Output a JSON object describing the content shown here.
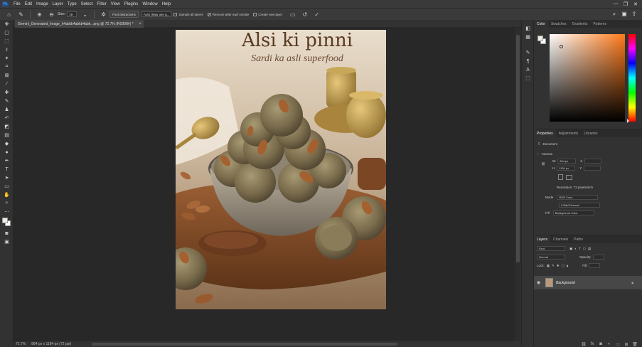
{
  "app": {
    "logo": "Ps"
  },
  "menu": [
    "File",
    "Edit",
    "Image",
    "Layer",
    "Type",
    "Select",
    "Filter",
    "View",
    "Plugins",
    "Window",
    "Help"
  ],
  "window_controls": {
    "minimize": "—",
    "restore": "❐",
    "close": "✕"
  },
  "options": {
    "size_label": "Size:",
    "size_value": "19",
    "find_distractions": "Find distractions",
    "mode_value": "Auto (May use g...",
    "sample_all_layers": "Sample all layers",
    "remove_after_stroke": "Remove after each stroke",
    "create_new_layer": "Create new layer"
  },
  "document": {
    "tab_title": "Gemini_Generated_Image_k4abkb4abkb4abk...png @ 72.7% (RGB/8#) *",
    "close": "×"
  },
  "artwork": {
    "title": "Alsi ki pinni",
    "subtitle": "Sardi ka asli superfood"
  },
  "status": {
    "zoom": "72.7%",
    "size": "864 px x 1184 px (72 ppi)"
  },
  "color_panel": {
    "tabs": [
      "Color",
      "Swatches",
      "Gradients",
      "Patterns"
    ],
    "hue_color": "#ff7a1a"
  },
  "properties_panel": {
    "tabs": [
      "Properties",
      "Adjustments",
      "Libraries"
    ],
    "type": "Document",
    "section": "Canvas",
    "w_label": "W",
    "w_value": "864 px",
    "h_label": "H",
    "h_value": "1184 px",
    "x_label": "X",
    "y_label": "Y",
    "resolution": "Resolution: 72 pixels/inch",
    "mode_label": "Mode",
    "mode_value": "RGB Color",
    "depth_value": "8 Bits/Channel",
    "fill_label": "Fill",
    "bg_color": "Background Color"
  },
  "layers_panel": {
    "tabs": [
      "Layers",
      "Channels",
      "Paths"
    ],
    "search": "Kind",
    "blend_mode": "Normal",
    "opacity_label": "Opacity:",
    "lock_label": "Lock:",
    "fill_label": "Fill:",
    "layer_name": "Background"
  }
}
